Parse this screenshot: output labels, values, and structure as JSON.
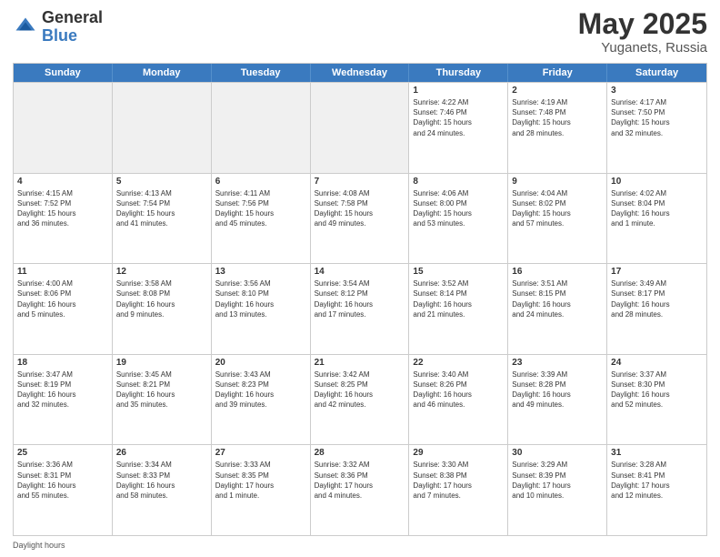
{
  "header": {
    "logo_general": "General",
    "logo_blue": "Blue",
    "title": "May 2025",
    "location": "Yuganets, Russia"
  },
  "calendar": {
    "days_of_week": [
      "Sunday",
      "Monday",
      "Tuesday",
      "Wednesday",
      "Thursday",
      "Friday",
      "Saturday"
    ],
    "weeks": [
      [
        {
          "day": "",
          "info": "",
          "shaded": true
        },
        {
          "day": "",
          "info": "",
          "shaded": true
        },
        {
          "day": "",
          "info": "",
          "shaded": true
        },
        {
          "day": "",
          "info": "",
          "shaded": true
        },
        {
          "day": "1",
          "info": "Sunrise: 4:22 AM\nSunset: 7:46 PM\nDaylight: 15 hours\nand 24 minutes.",
          "shaded": false
        },
        {
          "day": "2",
          "info": "Sunrise: 4:19 AM\nSunset: 7:48 PM\nDaylight: 15 hours\nand 28 minutes.",
          "shaded": false
        },
        {
          "day": "3",
          "info": "Sunrise: 4:17 AM\nSunset: 7:50 PM\nDaylight: 15 hours\nand 32 minutes.",
          "shaded": false
        }
      ],
      [
        {
          "day": "4",
          "info": "Sunrise: 4:15 AM\nSunset: 7:52 PM\nDaylight: 15 hours\nand 36 minutes.",
          "shaded": false
        },
        {
          "day": "5",
          "info": "Sunrise: 4:13 AM\nSunset: 7:54 PM\nDaylight: 15 hours\nand 41 minutes.",
          "shaded": false
        },
        {
          "day": "6",
          "info": "Sunrise: 4:11 AM\nSunset: 7:56 PM\nDaylight: 15 hours\nand 45 minutes.",
          "shaded": false
        },
        {
          "day": "7",
          "info": "Sunrise: 4:08 AM\nSunset: 7:58 PM\nDaylight: 15 hours\nand 49 minutes.",
          "shaded": false
        },
        {
          "day": "8",
          "info": "Sunrise: 4:06 AM\nSunset: 8:00 PM\nDaylight: 15 hours\nand 53 minutes.",
          "shaded": false
        },
        {
          "day": "9",
          "info": "Sunrise: 4:04 AM\nSunset: 8:02 PM\nDaylight: 15 hours\nand 57 minutes.",
          "shaded": false
        },
        {
          "day": "10",
          "info": "Sunrise: 4:02 AM\nSunset: 8:04 PM\nDaylight: 16 hours\nand 1 minute.",
          "shaded": false
        }
      ],
      [
        {
          "day": "11",
          "info": "Sunrise: 4:00 AM\nSunset: 8:06 PM\nDaylight: 16 hours\nand 5 minutes.",
          "shaded": false
        },
        {
          "day": "12",
          "info": "Sunrise: 3:58 AM\nSunset: 8:08 PM\nDaylight: 16 hours\nand 9 minutes.",
          "shaded": false
        },
        {
          "day": "13",
          "info": "Sunrise: 3:56 AM\nSunset: 8:10 PM\nDaylight: 16 hours\nand 13 minutes.",
          "shaded": false
        },
        {
          "day": "14",
          "info": "Sunrise: 3:54 AM\nSunset: 8:12 PM\nDaylight: 16 hours\nand 17 minutes.",
          "shaded": false
        },
        {
          "day": "15",
          "info": "Sunrise: 3:52 AM\nSunset: 8:14 PM\nDaylight: 16 hours\nand 21 minutes.",
          "shaded": false
        },
        {
          "day": "16",
          "info": "Sunrise: 3:51 AM\nSunset: 8:15 PM\nDaylight: 16 hours\nand 24 minutes.",
          "shaded": false
        },
        {
          "day": "17",
          "info": "Sunrise: 3:49 AM\nSunset: 8:17 PM\nDaylight: 16 hours\nand 28 minutes.",
          "shaded": false
        }
      ],
      [
        {
          "day": "18",
          "info": "Sunrise: 3:47 AM\nSunset: 8:19 PM\nDaylight: 16 hours\nand 32 minutes.",
          "shaded": false
        },
        {
          "day": "19",
          "info": "Sunrise: 3:45 AM\nSunset: 8:21 PM\nDaylight: 16 hours\nand 35 minutes.",
          "shaded": false
        },
        {
          "day": "20",
          "info": "Sunrise: 3:43 AM\nSunset: 8:23 PM\nDaylight: 16 hours\nand 39 minutes.",
          "shaded": false
        },
        {
          "day": "21",
          "info": "Sunrise: 3:42 AM\nSunset: 8:25 PM\nDaylight: 16 hours\nand 42 minutes.",
          "shaded": false
        },
        {
          "day": "22",
          "info": "Sunrise: 3:40 AM\nSunset: 8:26 PM\nDaylight: 16 hours\nand 46 minutes.",
          "shaded": false
        },
        {
          "day": "23",
          "info": "Sunrise: 3:39 AM\nSunset: 8:28 PM\nDaylight: 16 hours\nand 49 minutes.",
          "shaded": false
        },
        {
          "day": "24",
          "info": "Sunrise: 3:37 AM\nSunset: 8:30 PM\nDaylight: 16 hours\nand 52 minutes.",
          "shaded": false
        }
      ],
      [
        {
          "day": "25",
          "info": "Sunrise: 3:36 AM\nSunset: 8:31 PM\nDaylight: 16 hours\nand 55 minutes.",
          "shaded": false
        },
        {
          "day": "26",
          "info": "Sunrise: 3:34 AM\nSunset: 8:33 PM\nDaylight: 16 hours\nand 58 minutes.",
          "shaded": false
        },
        {
          "day": "27",
          "info": "Sunrise: 3:33 AM\nSunset: 8:35 PM\nDaylight: 17 hours\nand 1 minute.",
          "shaded": false
        },
        {
          "day": "28",
          "info": "Sunrise: 3:32 AM\nSunset: 8:36 PM\nDaylight: 17 hours\nand 4 minutes.",
          "shaded": false
        },
        {
          "day": "29",
          "info": "Sunrise: 3:30 AM\nSunset: 8:38 PM\nDaylight: 17 hours\nand 7 minutes.",
          "shaded": false
        },
        {
          "day": "30",
          "info": "Sunrise: 3:29 AM\nSunset: 8:39 PM\nDaylight: 17 hours\nand 10 minutes.",
          "shaded": false
        },
        {
          "day": "31",
          "info": "Sunrise: 3:28 AM\nSunset: 8:41 PM\nDaylight: 17 hours\nand 12 minutes.",
          "shaded": false
        }
      ]
    ]
  },
  "footer": {
    "text": "Daylight hours"
  }
}
